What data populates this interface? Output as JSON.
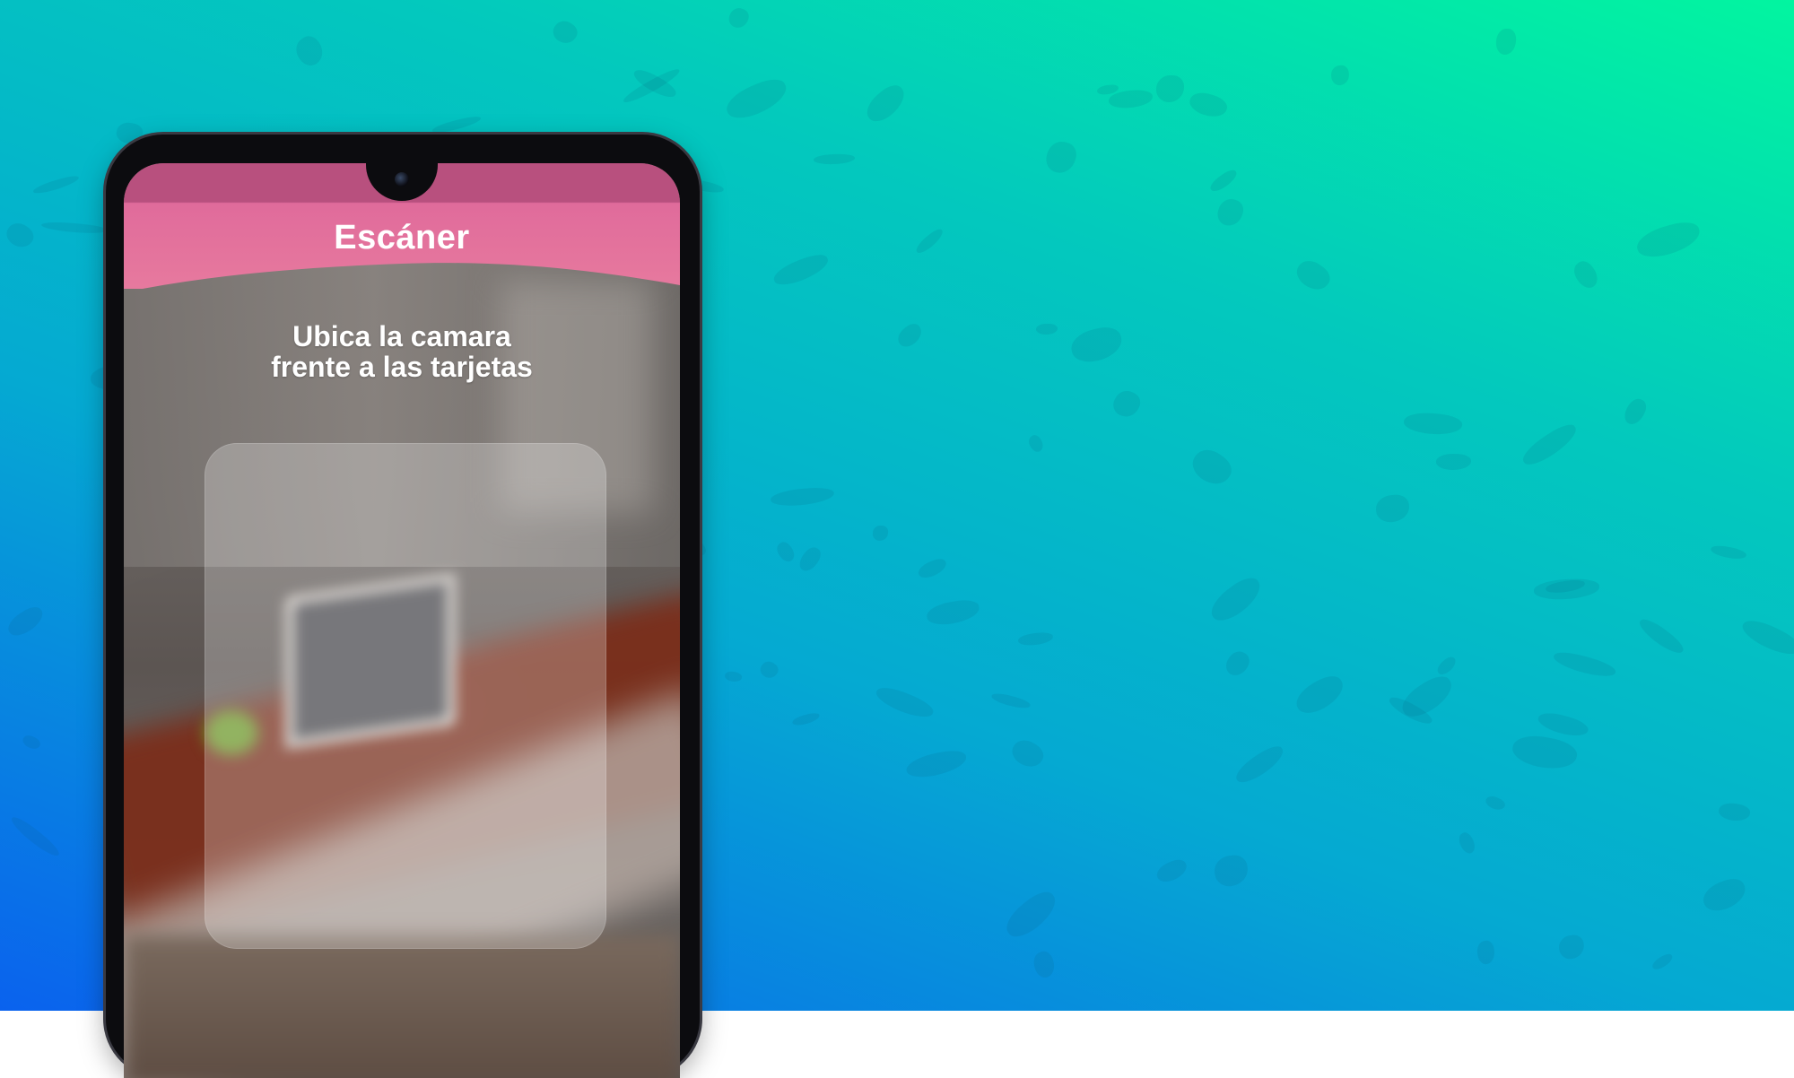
{
  "app": {
    "header": {
      "title": "Escáner"
    },
    "instruction": {
      "line1": "Ubica la camara",
      "line2": "frente a las tarjetas"
    }
  },
  "colors": {
    "header_pink": "#e26b9a",
    "header_pink_dark": "#b8507e",
    "background_top_right": "#02f5a0",
    "background_bottom_left": "#0a62ee"
  },
  "icons": [
    "front-camera-icon"
  ]
}
